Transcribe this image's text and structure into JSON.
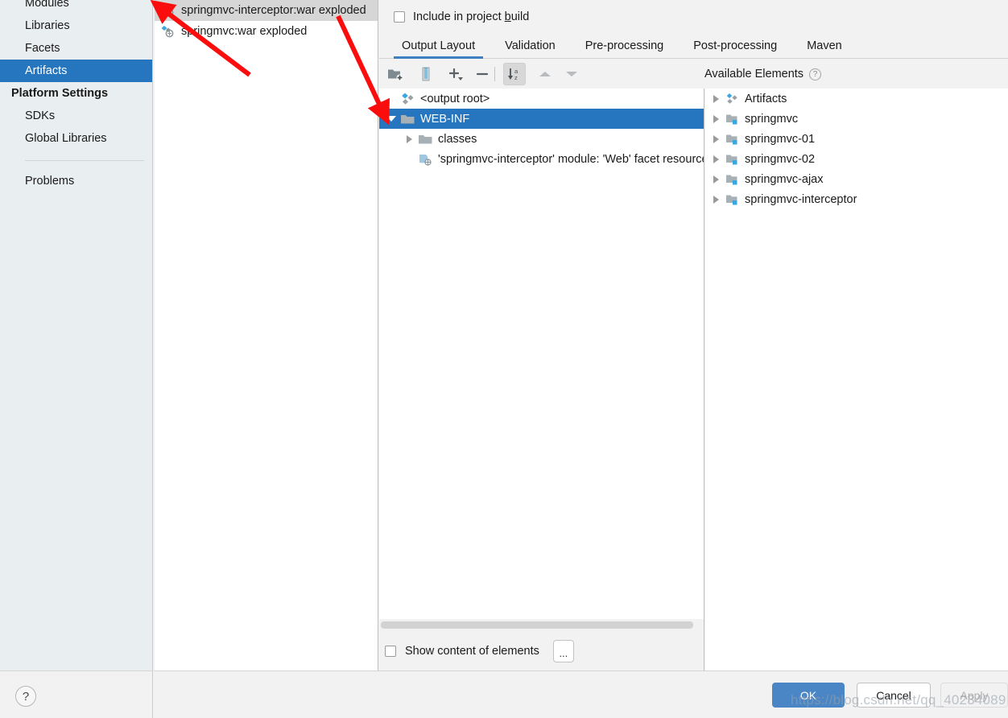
{
  "sidebar": {
    "items": [
      {
        "label": "Modules",
        "type": "item",
        "selected": false
      },
      {
        "label": "Libraries",
        "type": "item",
        "selected": false
      },
      {
        "label": "Facets",
        "type": "item",
        "selected": false
      },
      {
        "label": "Artifacts",
        "type": "item",
        "selected": true
      },
      {
        "label": "Platform Settings",
        "type": "header",
        "selected": false
      },
      {
        "label": "SDKs",
        "type": "item",
        "selected": false
      },
      {
        "label": "Global Libraries",
        "type": "item",
        "selected": false
      },
      {
        "label": "Problems",
        "type": "item",
        "selected": false
      }
    ],
    "help_glyph": "?"
  },
  "artifacts": {
    "items": [
      {
        "label": "springmvc-interceptor:war exploded",
        "selected": true
      },
      {
        "label": "springmvc:war exploded",
        "selected": false
      }
    ]
  },
  "editor": {
    "include_in_build": {
      "label_before": "Include in project ",
      "label_mnemonic": "b",
      "label_after": "uild",
      "checked": false
    },
    "tabs": [
      {
        "label": "Output Layout",
        "active": true
      },
      {
        "label": "Validation",
        "active": false
      },
      {
        "label": "Pre-processing",
        "active": false
      },
      {
        "label": "Post-processing",
        "active": false
      },
      {
        "label": "Maven",
        "active": false
      }
    ],
    "toolbar": [
      {
        "name": "create-directory-icon",
        "pressed": false
      },
      {
        "name": "create-archive-icon",
        "pressed": false
      },
      {
        "name": "add-icon",
        "pressed": false
      },
      {
        "name": "remove-icon",
        "pressed": false
      },
      {
        "name": "sort-alphabetically-icon",
        "pressed": true
      },
      {
        "name": "move-up-icon",
        "pressed": false
      },
      {
        "name": "move-down-icon",
        "pressed": false
      }
    ],
    "available_elements": {
      "title": "Available Elements",
      "help_glyph": "?"
    },
    "output_tree": [
      {
        "label": "<output root>",
        "indent": 0,
        "icon": "artifact-icon",
        "twisty": "none",
        "selected": false
      },
      {
        "label": "WEB-INF",
        "indent": 0,
        "icon": "folder-icon",
        "twisty": "down",
        "selected": true
      },
      {
        "label": "classes",
        "indent": 1,
        "icon": "folder-icon",
        "twisty": "right",
        "selected": false
      },
      {
        "label": "'springmvc-interceptor' module: 'Web' facet resources",
        "indent": 1,
        "icon": "facet-resource-icon",
        "twisty": "none",
        "selected": false
      }
    ],
    "available_tree": [
      {
        "label": "Artifacts",
        "icon": "artifact-icon",
        "twisty": "right"
      },
      {
        "label": "springmvc",
        "icon": "module-icon",
        "twisty": "right"
      },
      {
        "label": "springmvc-01",
        "icon": "module-icon",
        "twisty": "right"
      },
      {
        "label": "springmvc-02",
        "icon": "module-icon",
        "twisty": "right"
      },
      {
        "label": "springmvc-ajax",
        "icon": "module-icon",
        "twisty": "right"
      },
      {
        "label": "springmvc-interceptor",
        "icon": "module-icon",
        "twisty": "right"
      }
    ],
    "show_content": {
      "label": "Show content of elements",
      "checked": false,
      "ellipsis_label": "..."
    }
  },
  "footer": {
    "ok": "OK",
    "cancel": "Cancel",
    "apply": "Apply"
  },
  "watermark": "https://blog.csdn.net/qq_40234089",
  "colors": {
    "selection_blue": "#2675bf",
    "tab_underline": "#3d7fc1",
    "ok_button": "#4a86c5",
    "sidebar_bg": "#e9eef0",
    "annotation_red": "#fb0d0d"
  }
}
